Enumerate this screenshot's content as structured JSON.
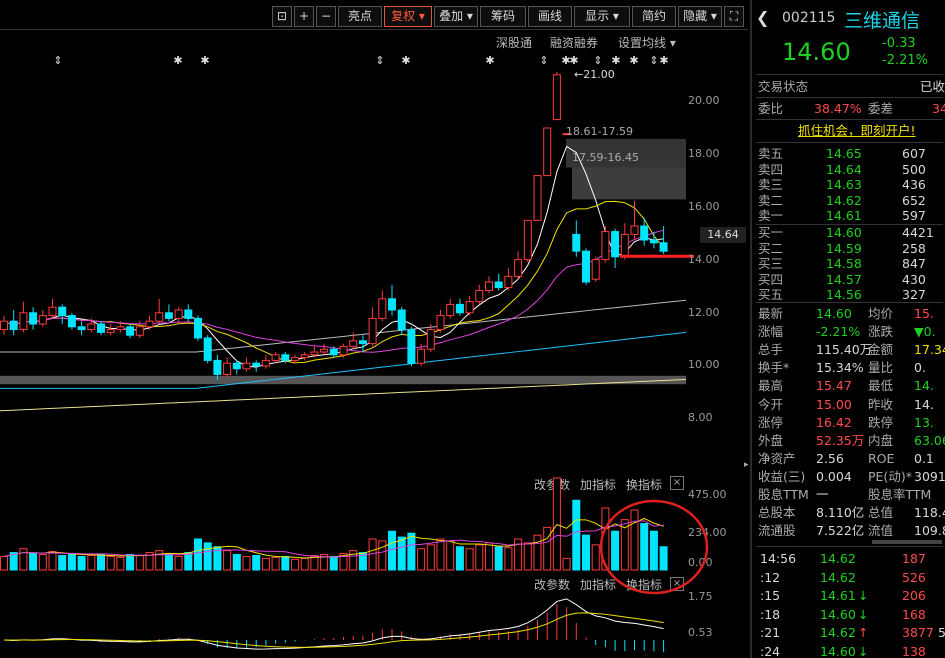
{
  "toolbar": {
    "buttons": [
      {
        "label": "亮点"
      },
      {
        "label": "复权 ▾"
      },
      {
        "label": "叠加 ▾"
      },
      {
        "label": "筹码"
      },
      {
        "label": "画线"
      },
      {
        "label": "显示 ▾"
      },
      {
        "label": "简约"
      },
      {
        "label": "隐藏 ▾"
      }
    ],
    "links": [
      "深股通",
      "融资融券",
      "设置均线 ▾"
    ]
  },
  "chart": {
    "price_axis": [
      "20.00",
      "18.00",
      "16.00",
      "14.00",
      "12.00",
      "10.00",
      "8.00"
    ],
    "current_price_tag": "14.64",
    "high_label": "21.00",
    "zone1_label": "18.61-17.59",
    "zone2_label": "17.59-16.45",
    "volume_axis": [
      "475.00",
      "234.00",
      "0.00"
    ],
    "macd_axis": [
      "1.75",
      "0.53"
    ],
    "panel_links": [
      "改参数",
      "加指标",
      "换指标"
    ]
  },
  "chart_data": {
    "type": "candlestick",
    "ylim": [
      7,
      22
    ],
    "candles": [
      {
        "o": 11.8,
        "c": 12.1,
        "h": 12.3,
        "l": 11.6
      },
      {
        "o": 12.1,
        "c": 11.8,
        "h": 12.5,
        "l": 11.6
      },
      {
        "o": 11.8,
        "c": 12.4,
        "h": 12.8,
        "l": 11.7
      },
      {
        "o": 12.4,
        "c": 12.0,
        "h": 12.6,
        "l": 11.8
      },
      {
        "o": 12.0,
        "c": 12.3,
        "h": 12.5,
        "l": 11.9
      },
      {
        "o": 12.3,
        "c": 12.6,
        "h": 12.9,
        "l": 12.2
      },
      {
        "o": 12.6,
        "c": 12.3,
        "h": 12.7,
        "l": 12.0
      },
      {
        "o": 12.3,
        "c": 11.9,
        "h": 12.4,
        "l": 11.8
      },
      {
        "o": 11.9,
        "c": 11.8,
        "h": 12.1,
        "l": 11.6
      },
      {
        "o": 11.8,
        "c": 12.0,
        "h": 12.2,
        "l": 11.7
      },
      {
        "o": 12.0,
        "c": 11.7,
        "h": 12.1,
        "l": 11.6
      },
      {
        "o": 11.7,
        "c": 11.8,
        "h": 12.0,
        "l": 11.6
      },
      {
        "o": 11.8,
        "c": 11.9,
        "h": 12.1,
        "l": 11.7
      },
      {
        "o": 11.9,
        "c": 11.6,
        "h": 12.0,
        "l": 11.5
      },
      {
        "o": 11.6,
        "c": 11.9,
        "h": 12.1,
        "l": 11.5
      },
      {
        "o": 11.9,
        "c": 12.1,
        "h": 12.3,
        "l": 11.8
      },
      {
        "o": 12.1,
        "c": 12.4,
        "h": 12.9,
        "l": 12.0
      },
      {
        "o": 12.4,
        "c": 12.2,
        "h": 12.7,
        "l": 12.1
      },
      {
        "o": 12.2,
        "c": 12.5,
        "h": 12.6,
        "l": 12.0
      },
      {
        "o": 12.5,
        "c": 12.2,
        "h": 12.7,
        "l": 12.1
      },
      {
        "o": 12.2,
        "c": 11.5,
        "h": 12.3,
        "l": 11.4
      },
      {
        "o": 11.5,
        "c": 10.7,
        "h": 11.6,
        "l": 10.6
      },
      {
        "o": 10.7,
        "c": 10.2,
        "h": 10.9,
        "l": 10.0
      },
      {
        "o": 10.2,
        "c": 10.6,
        "h": 10.8,
        "l": 10.1
      },
      {
        "o": 10.6,
        "c": 10.4,
        "h": 10.7,
        "l": 10.2
      },
      {
        "o": 10.4,
        "c": 10.6,
        "h": 10.8,
        "l": 10.3
      },
      {
        "o": 10.6,
        "c": 10.5,
        "h": 10.7,
        "l": 10.3
      },
      {
        "o": 10.5,
        "c": 10.7,
        "h": 10.9,
        "l": 10.4
      },
      {
        "o": 10.7,
        "c": 10.9,
        "h": 11.0,
        "l": 10.6
      },
      {
        "o": 10.9,
        "c": 10.7,
        "h": 11.0,
        "l": 10.6
      },
      {
        "o": 10.7,
        "c": 10.8,
        "h": 10.9,
        "l": 10.6
      },
      {
        "o": 10.8,
        "c": 10.9,
        "h": 11.0,
        "l": 10.7
      },
      {
        "o": 10.9,
        "c": 11.0,
        "h": 11.2,
        "l": 10.8
      },
      {
        "o": 11.0,
        "c": 11.1,
        "h": 11.3,
        "l": 10.9
      },
      {
        "o": 11.1,
        "c": 10.9,
        "h": 11.2,
        "l": 10.8
      },
      {
        "o": 10.9,
        "c": 11.2,
        "h": 11.3,
        "l": 10.8
      },
      {
        "o": 11.2,
        "c": 11.4,
        "h": 11.7,
        "l": 11.1
      },
      {
        "o": 11.4,
        "c": 11.3,
        "h": 11.6,
        "l": 11.0
      },
      {
        "o": 11.3,
        "c": 12.2,
        "h": 12.6,
        "l": 11.2
      },
      {
        "o": 12.2,
        "c": 12.9,
        "h": 13.2,
        "l": 12.1
      },
      {
        "o": 12.9,
        "c": 12.5,
        "h": 13.4,
        "l": 12.3
      },
      {
        "o": 12.5,
        "c": 11.8,
        "h": 12.6,
        "l": 11.6
      },
      {
        "o": 11.8,
        "c": 10.6,
        "h": 11.9,
        "l": 10.5
      },
      {
        "o": 10.6,
        "c": 11.1,
        "h": 11.3,
        "l": 10.5
      },
      {
        "o": 11.1,
        "c": 11.8,
        "h": 12.0,
        "l": 11.0
      },
      {
        "o": 11.8,
        "c": 12.3,
        "h": 12.5,
        "l": 11.7
      },
      {
        "o": 12.3,
        "c": 12.7,
        "h": 12.9,
        "l": 12.2
      },
      {
        "o": 12.7,
        "c": 12.4,
        "h": 12.9,
        "l": 12.3
      },
      {
        "o": 12.4,
        "c": 12.8,
        "h": 13.0,
        "l": 12.3
      },
      {
        "o": 12.8,
        "c": 13.2,
        "h": 13.4,
        "l": 12.7
      },
      {
        "o": 13.2,
        "c": 13.5,
        "h": 13.7,
        "l": 13.1
      },
      {
        "o": 13.5,
        "c": 13.3,
        "h": 13.8,
        "l": 13.2
      },
      {
        "o": 13.3,
        "c": 13.7,
        "h": 14.0,
        "l": 13.2
      },
      {
        "o": 13.7,
        "c": 14.3,
        "h": 14.6,
        "l": 13.6
      },
      {
        "o": 14.3,
        "c": 15.7,
        "h": 15.7,
        "l": 14.2
      },
      {
        "o": 15.7,
        "c": 17.3,
        "h": 17.3,
        "l": 15.7
      },
      {
        "o": 17.3,
        "c": 19.0,
        "h": 19.0,
        "l": 17.3
      },
      {
        "o": 19.3,
        "c": 20.9,
        "h": 21.0,
        "l": 19.3
      },
      {
        "o": 18.8,
        "c": 18.8,
        "h": 18.8,
        "l": 18.8
      },
      {
        "o": 15.2,
        "c": 14.6,
        "h": 15.7,
        "l": 14.4
      },
      {
        "o": 14.6,
        "c": 13.5,
        "h": 14.7,
        "l": 13.4
      },
      {
        "o": 13.6,
        "c": 14.3,
        "h": 14.4,
        "l": 13.5
      },
      {
        "o": 14.3,
        "c": 15.3,
        "h": 15.5,
        "l": 14.2
      },
      {
        "o": 15.3,
        "c": 14.4,
        "h": 15.4,
        "l": 14.0
      },
      {
        "o": 14.4,
        "c": 15.2,
        "h": 15.6,
        "l": 14.3
      },
      {
        "o": 15.2,
        "c": 15.5,
        "h": 16.4,
        "l": 15.0
      },
      {
        "o": 15.5,
        "c": 15.0,
        "h": 15.8,
        "l": 14.8
      },
      {
        "o": 15.0,
        "c": 14.9,
        "h": 15.3,
        "l": 14.7
      },
      {
        "o": 14.9,
        "c": 14.6,
        "h": 15.5,
        "l": 14.5
      }
    ],
    "volume": [
      70,
      90,
      110,
      85,
      80,
      95,
      75,
      80,
      70,
      75,
      80,
      70,
      65,
      80,
      75,
      90,
      100,
      85,
      70,
      90,
      160,
      140,
      120,
      100,
      80,
      70,
      75,
      60,
      65,
      70,
      55,
      60,
      75,
      80,
      70,
      85,
      100,
      90,
      160,
      150,
      200,
      170,
      190,
      110,
      130,
      160,
      150,
      120,
      110,
      130,
      140,
      120,
      115,
      160,
      140,
      180,
      220,
      475,
      60,
      360,
      180,
      130,
      320,
      200,
      260,
      310,
      240,
      200,
      120
    ]
  },
  "quote": {
    "code": "002115",
    "name": "三维通信",
    "price": "14.60",
    "change": "-0.33",
    "change_pct": "-2.21%",
    "status_label": "交易状态",
    "status_value": "已收",
    "weibi_label": "委比",
    "weibi_value": "38.47%",
    "weicha_label": "委差",
    "weicha_value": "34",
    "promo": "抓住机会，即刻开户!",
    "asks": [
      {
        "label": "卖五",
        "price": "14.65",
        "vol": "607"
      },
      {
        "label": "卖四",
        "price": "14.64",
        "vol": "500"
      },
      {
        "label": "卖三",
        "price": "14.63",
        "vol": "436"
      },
      {
        "label": "卖二",
        "price": "14.62",
        "vol": "652"
      },
      {
        "label": "卖一",
        "price": "14.61",
        "vol": "597"
      }
    ],
    "bids": [
      {
        "label": "买一",
        "price": "14.60",
        "vol": "4421"
      },
      {
        "label": "买二",
        "price": "14.59",
        "vol": "258"
      },
      {
        "label": "买三",
        "price": "14.58",
        "vol": "847"
      },
      {
        "label": "买四",
        "price": "14.57",
        "vol": "430"
      },
      {
        "label": "买五",
        "price": "14.56",
        "vol": "327"
      }
    ],
    "stats": [
      {
        "l1": "最新",
        "v1": "14.60",
        "c1": "down",
        "l2": "均价",
        "v2": "15.",
        "c2": "up"
      },
      {
        "l1": "涨幅",
        "v1": "-2.21%",
        "c1": "down",
        "l2": "涨跌",
        "v2": "▼0.",
        "c2": "down"
      },
      {
        "l1": "总手",
        "v1": "115.40万",
        "c1": "neutral",
        "l2": "金额",
        "v2": "17.34",
        "c2": "yellow"
      },
      {
        "l1": "换手*",
        "v1": "15.34%",
        "c1": "neutral",
        "l2": "量比",
        "v2": "0.",
        "c2": "neutral"
      },
      {
        "l1": "最高",
        "v1": "15.47",
        "c1": "up",
        "l2": "最低",
        "v2": "14.",
        "c2": "down"
      },
      {
        "l1": "今开",
        "v1": "15.00",
        "c1": "up",
        "l2": "昨收",
        "v2": "14.",
        "c2": "neutral"
      },
      {
        "l1": "涨停",
        "v1": "16.42",
        "c1": "up",
        "l2": "跌停",
        "v2": "13.",
        "c2": "down"
      },
      {
        "l1": "外盘",
        "v1": "52.35万",
        "c1": "up",
        "l2": "内盘",
        "v2": "63.06",
        "c2": "down"
      },
      {
        "l1": "净资产",
        "v1": "2.56",
        "c1": "neutral",
        "l2": "ROE",
        "v2": "0.1",
        "c2": "neutral"
      },
      {
        "l1": "收益(三)",
        "v1": "0.004",
        "c1": "neutral",
        "l2": "PE(动)*",
        "v2": "3091",
        "c2": "neutral"
      },
      {
        "l1": "股息TTM",
        "v1": "一",
        "c1": "neutral",
        "l2": "股息率TTM",
        "v2": "",
        "c2": "neutral"
      },
      {
        "l1": "总股本",
        "v1": "8.110亿",
        "c1": "neutral",
        "l2": "总值",
        "v2": "118.4",
        "c2": "neutral"
      },
      {
        "l1": "流通股",
        "v1": "7.522亿",
        "c1": "neutral",
        "l2": "流值",
        "v2": "109.8",
        "c2": "neutral"
      }
    ],
    "ticks": [
      {
        "time": "14:56",
        "price": "14.62",
        "arrow": "",
        "vol": "187",
        "extra": ""
      },
      {
        "time": ":12",
        "price": "14.62",
        "arrow": "",
        "vol": "526",
        "extra": ""
      },
      {
        "time": ":15",
        "price": "14.61",
        "arrow": "↓",
        "vol": "206",
        "extra": ""
      },
      {
        "time": ":18",
        "price": "14.60",
        "arrow": "↓",
        "vol": "168",
        "extra": ""
      },
      {
        "time": ":21",
        "price": "14.62",
        "arrow": "↑",
        "vol": "3877",
        "extra": "5"
      },
      {
        "time": ":24",
        "price": "14.60",
        "arrow": "↓",
        "vol": "138",
        "extra": ""
      }
    ]
  },
  "colors": {
    "up": "#ff3b3b",
    "down": "#00e5ff",
    "ma5": "#ffffff",
    "ma10": "#f0e000",
    "ma20": "#e040e0",
    "ma60": "#20c0ff",
    "circle": "#e02020"
  }
}
